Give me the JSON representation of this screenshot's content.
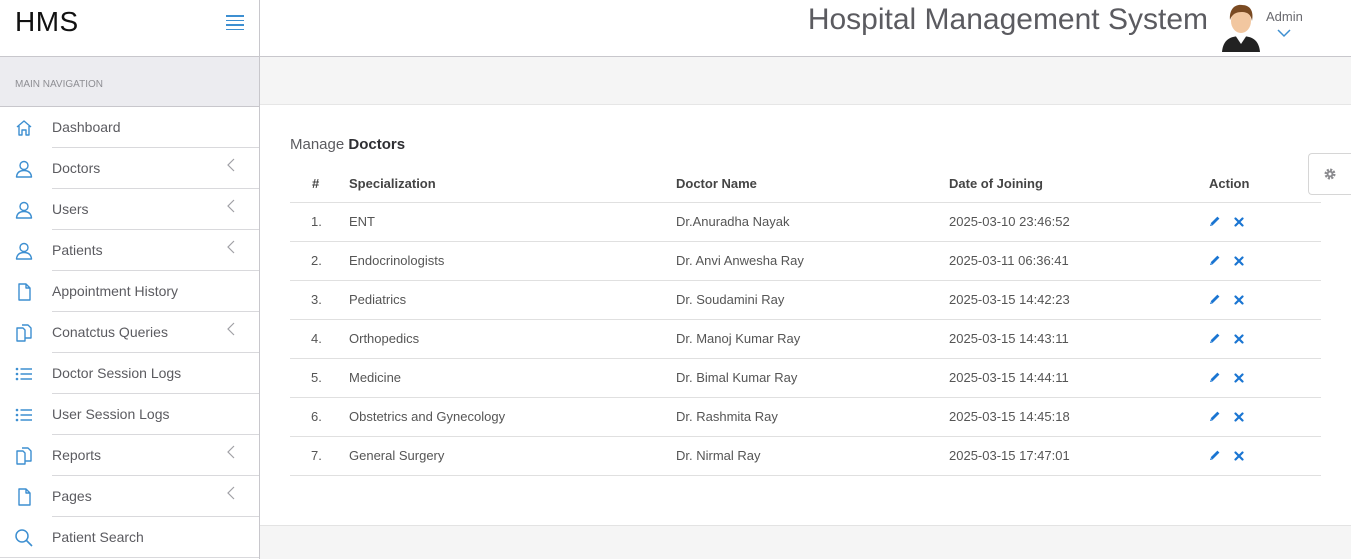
{
  "brand": {
    "title": "HMS"
  },
  "header": {
    "app_title": "Hospital Management System",
    "user_name": "Admin"
  },
  "sidebar": {
    "section_label": "MAIN NAVIGATION",
    "items": [
      {
        "label": "Dashboard",
        "icon": "home-icon",
        "has_submenu": false
      },
      {
        "label": "Doctors",
        "icon": "user-icon",
        "has_submenu": true
      },
      {
        "label": "Users",
        "icon": "user-icon",
        "has_submenu": true
      },
      {
        "label": "Patients",
        "icon": "user-icon",
        "has_submenu": true
      },
      {
        "label": "Appointment History",
        "icon": "file-icon",
        "has_submenu": false
      },
      {
        "label": "Conatctus Queries",
        "icon": "files-icon",
        "has_submenu": true
      },
      {
        "label": "Doctor Session Logs",
        "icon": "list-icon",
        "has_submenu": false
      },
      {
        "label": "User Session Logs",
        "icon": "list-icon",
        "has_submenu": false
      },
      {
        "label": "Reports",
        "icon": "files-icon",
        "has_submenu": true
      },
      {
        "label": "Pages",
        "icon": "file-icon",
        "has_submenu": true
      },
      {
        "label": "Patient Search",
        "icon": "search-icon",
        "has_submenu": false
      }
    ]
  },
  "main": {
    "title_prefix": "Manage",
    "title_main": "Doctors",
    "table": {
      "headers": [
        "#",
        "Specialization",
        "Doctor Name",
        "Date of Joining",
        "Action"
      ],
      "rows": [
        {
          "num": "1.",
          "specialization": "ENT",
          "doctor": "Dr.Anuradha Nayak",
          "date": "2025-03-10 23:46:52"
        },
        {
          "num": "2.",
          "specialization": "Endocrinologists",
          "doctor": "Dr. Anvi Anwesha Ray",
          "date": "2025-03-11 06:36:41"
        },
        {
          "num": "3.",
          "specialization": "Pediatrics",
          "doctor": "Dr. Soudamini Ray",
          "date": "2025-03-15 14:42:23"
        },
        {
          "num": "4.",
          "specialization": "Orthopedics",
          "doctor": "Dr. Manoj Kumar Ray",
          "date": "2025-03-15 14:43:11"
        },
        {
          "num": "5.",
          "specialization": "Medicine",
          "doctor": "Dr. Bimal Kumar Ray",
          "date": "2025-03-15 14:44:11"
        },
        {
          "num": "6.",
          "specialization": "Obstetrics and Gynecology",
          "doctor": "Dr. Rashmita Ray",
          "date": "2025-03-15 14:45:18"
        },
        {
          "num": "7.",
          "specialization": "General Surgery",
          "doctor": "Dr. Nirmal Ray",
          "date": "2025-03-15 17:47:01"
        }
      ]
    }
  },
  "colors": {
    "accent": "#3d8fd1",
    "action": "#1a75d2",
    "sidebar_header_bg": "#ececf0"
  }
}
